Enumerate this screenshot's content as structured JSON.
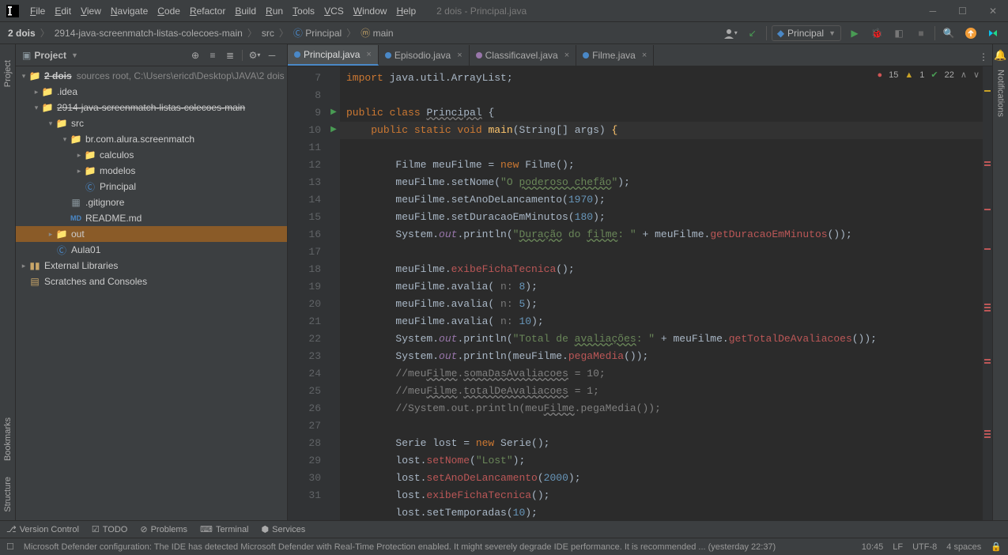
{
  "window": {
    "title": "2 dois - Principal.java"
  },
  "menu": [
    "File",
    "Edit",
    "View",
    "Navigate",
    "Code",
    "Refactor",
    "Build",
    "Run",
    "Tools",
    "VCS",
    "Window",
    "Help"
  ],
  "breadcrumbs": [
    "2 dois",
    "2914-java-screenmatch-listas-colecoes-main",
    "src",
    "Principal",
    "main"
  ],
  "runConfig": "Principal",
  "projectPanel": {
    "title": "Project"
  },
  "tree": {
    "root": "2 dois",
    "rootHint": "sources root,  C:\\Users\\ericd\\Desktop\\JAVA\\2 dois",
    "idea": ".idea",
    "repo": "2914-java-screenmatch-listas-colecoes-main",
    "src": "src",
    "pkg": "br.com.alura.screenmatch",
    "calculos": "calculos",
    "modelos": "modelos",
    "principal": "Principal",
    "gitignore": ".gitignore",
    "readme": "README.md",
    "out": "out",
    "aula01": "Aula01",
    "extLib": "External Libraries",
    "scratches": "Scratches and Consoles"
  },
  "tabs": [
    {
      "name": "Principal.java",
      "color": "#4a88c7",
      "active": true
    },
    {
      "name": "Episodio.java",
      "color": "#4a88c7",
      "active": false
    },
    {
      "name": "Classificavel.java",
      "color": "#9876aa",
      "active": false
    },
    {
      "name": "Filme.java",
      "color": "#4a88c7",
      "active": false
    }
  ],
  "inspections": {
    "errors": "15",
    "warnings": "1",
    "checks": "22"
  },
  "code": {
    "startLine": 7,
    "lines": [
      {
        "n": 7,
        "html": "<span class='kw'>import</span> java.util.ArrayList;"
      },
      {
        "n": 8,
        "html": ""
      },
      {
        "n": 9,
        "run": true,
        "html": "<span class='kw'>public class</span> <span style='text-decoration:underline wavy #808080'>Principal</span> {"
      },
      {
        "n": 10,
        "run": true,
        "hl": true,
        "html": "    <span class='kw'>public static void</span> <span class='fn'>main</span>(String[] args) <span class='fn'>{</span>"
      },
      {
        "n": 11,
        "html": "        Filme meuFilme = <span class='kw'>new</span> Filme();"
      },
      {
        "n": 12,
        "html": "        meuFilme.setNome(<span class='str'>\"O <span style='text-decoration:underline wavy #6a8759'>poderoso chefão</span>\"</span>);"
      },
      {
        "n": 13,
        "html": "        meuFilme.setAnoDeLancamento(<span class='num'>1970</span>);"
      },
      {
        "n": 14,
        "html": "        meuFilme.setDuracaoEmMinutos(<span class='num'>180</span>);"
      },
      {
        "n": 15,
        "html": "        System.<span class='fld'>out</span>.println(<span class='str'>\"<span style='text-decoration:underline wavy #6a8759'>Duração</span> do <span style='text-decoration:underline wavy #6a8759'>filme</span>: \"</span> + meuFilme.<span class='warn'>getDuracaoEmMinutos</span>());"
      },
      {
        "n": 16,
        "html": ""
      },
      {
        "n": 17,
        "html": "        meuFilme.<span class='warn'>exibeFichaTecnica</span>();"
      },
      {
        "n": 18,
        "html": "        meuFilme.avalia( <span style='color:#787878'>n:</span> <span class='num'>8</span>);"
      },
      {
        "n": 19,
        "html": "        meuFilme.avalia( <span style='color:#787878'>n:</span> <span class='num'>5</span>);"
      },
      {
        "n": 20,
        "html": "        meuFilme.avalia( <span style='color:#787878'>n:</span> <span class='num'>10</span>);"
      },
      {
        "n": 21,
        "html": "        System.<span class='fld'>out</span>.println(<span class='str'>\"Total de <span style='text-decoration:underline wavy #6a8759'>avaliações</span>: \"</span> + meuFilme.<span class='warn'>getTotalDeAvaliacoes</span>());"
      },
      {
        "n": 22,
        "html": "        System.<span class='fld'>out</span>.println(meuFilme.<span class='warn'>pegaMedia</span>());"
      },
      {
        "n": 23,
        "html": "        <span class='com'>//meu<span style='text-decoration:underline wavy #808080'>Filme</span>.<span style='text-decoration:underline wavy #808080'>somaDasAvaliacoes</span> = 10;</span>"
      },
      {
        "n": 24,
        "html": "        <span class='com'>//meu<span style='text-decoration:underline wavy #808080'>Filme</span>.<span style='text-decoration:underline wavy #808080'>totalDeAvaliacoes</span> = 1;</span>"
      },
      {
        "n": 25,
        "html": "        <span class='com'>//System.out.println(meu<span style='text-decoration:underline wavy #808080'>Filme</span>.pegaMedia());</span>"
      },
      {
        "n": 26,
        "html": ""
      },
      {
        "n": 27,
        "html": "        Serie lost = <span class='kw'>new</span> Serie();"
      },
      {
        "n": 28,
        "html": "        lost.<span class='warn'>setNome</span>(<span class='str'>\"Lost\"</span>);"
      },
      {
        "n": 29,
        "html": "        lost.<span class='warn'>setAnoDeLancamento</span>(<span class='num'>2000</span>);"
      },
      {
        "n": 30,
        "html": "        lost.<span class='warn'>exibeFichaTecnica</span>();"
      },
      {
        "n": 31,
        "html": "        lost.setTemporadas(<span class='num'>10</span>);"
      }
    ]
  },
  "toolWindows": [
    "Version Control",
    "TODO",
    "Problems",
    "Terminal",
    "Services"
  ],
  "status": {
    "msg": "Microsoft Defender configuration: The IDE has detected Microsoft Defender with Real-Time Protection enabled. It might severely degrade IDE performance. It is recommended ... (yesterday 22:37)",
    "pos": "10:45",
    "sep": "LF",
    "enc": "UTF-8",
    "indent": "4 spaces"
  },
  "leftBar": {
    "project": "Project",
    "bookmarks": "Bookmarks",
    "structure": "Structure"
  },
  "rightBar": {
    "notifications": "Notifications"
  }
}
